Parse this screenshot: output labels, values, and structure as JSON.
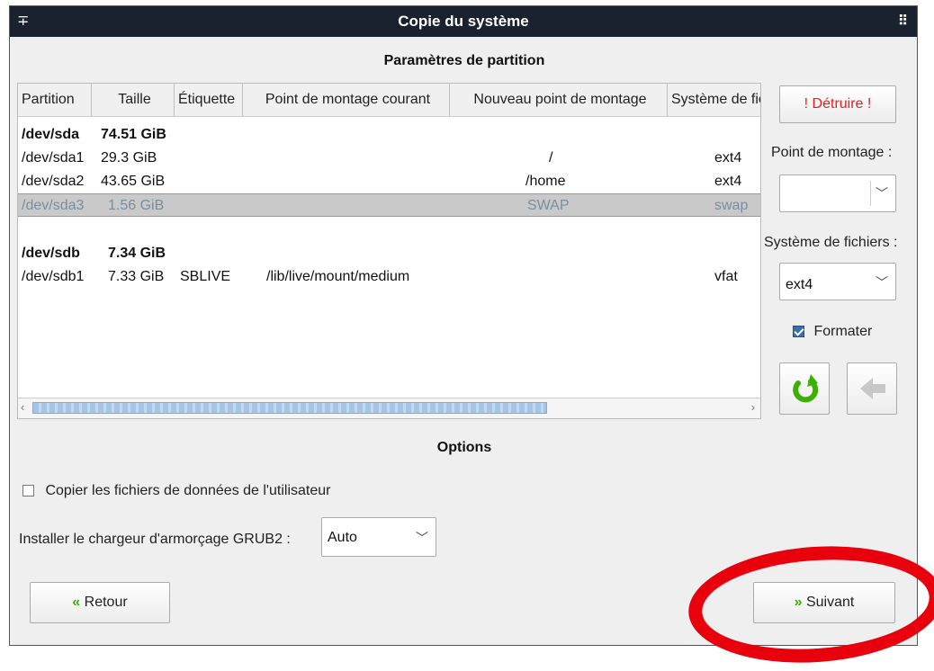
{
  "window": {
    "title": "Copie du système",
    "pin_glyph": "∓",
    "menu_glyph": "⠿"
  },
  "partition": {
    "section_title": "Paramètres de partition",
    "columns": [
      "Partition",
      "Taille",
      "Étiquette",
      "Point de montage courant",
      "Nouveau point de montage",
      "Système de fic"
    ],
    "disks": [
      {
        "name": "/dev/sda",
        "size": "74.51 GiB",
        "partitions": [
          {
            "name": "/dev/sda1",
            "size": "29.3 GiB",
            "label": "",
            "current_mount": "",
            "new_mount": "/",
            "fs": "ext4",
            "selected": false
          },
          {
            "name": "/dev/sda2",
            "size": "43.65 GiB",
            "label": "",
            "current_mount": "",
            "new_mount": "/home",
            "fs": "ext4",
            "selected": false
          },
          {
            "name": "/dev/sda3",
            "size": "1.56 GiB",
            "label": "",
            "current_mount": "",
            "new_mount": "SWAP",
            "fs": "swap",
            "selected": true
          }
        ]
      },
      {
        "name": "/dev/sdb",
        "size": "7.34 GiB",
        "partitions": [
          {
            "name": "/dev/sdb1",
            "size": "7.33 GiB",
            "label": "SBLIVE",
            "current_mount": "/lib/live/mount/medium",
            "new_mount": "",
            "fs": "vfat",
            "selected": false
          }
        ]
      }
    ]
  },
  "side": {
    "destroy_label": "! Détruire !",
    "mount_label": "Point de montage :",
    "mount_value": "",
    "fs_label": "Système de fichiers :",
    "fs_value": "ext4",
    "format_label": "Formater",
    "format_checked": true
  },
  "options": {
    "title": "Options",
    "copy_user_label": "Copier les fichiers de données de l'utilisateur",
    "copy_user_checked": false,
    "grub_label": "Installer le chargeur d'armorçage GRUB2 :",
    "grub_value": "Auto"
  },
  "nav": {
    "back_label": "Retour",
    "next_label": "Suivant",
    "back_glyph": "«",
    "next_glyph": "»"
  },
  "colors": {
    "titlebar": "#1a2230",
    "destroy_text": "#e02020",
    "nav_arrows": "#3bb000",
    "refresh_icon": "#3bb000",
    "annotation": "#e8000d"
  },
  "icons": {
    "chevron": "chevron-down-icon",
    "refresh": "refresh-icon",
    "back_arrow": "arrow-left-icon"
  }
}
